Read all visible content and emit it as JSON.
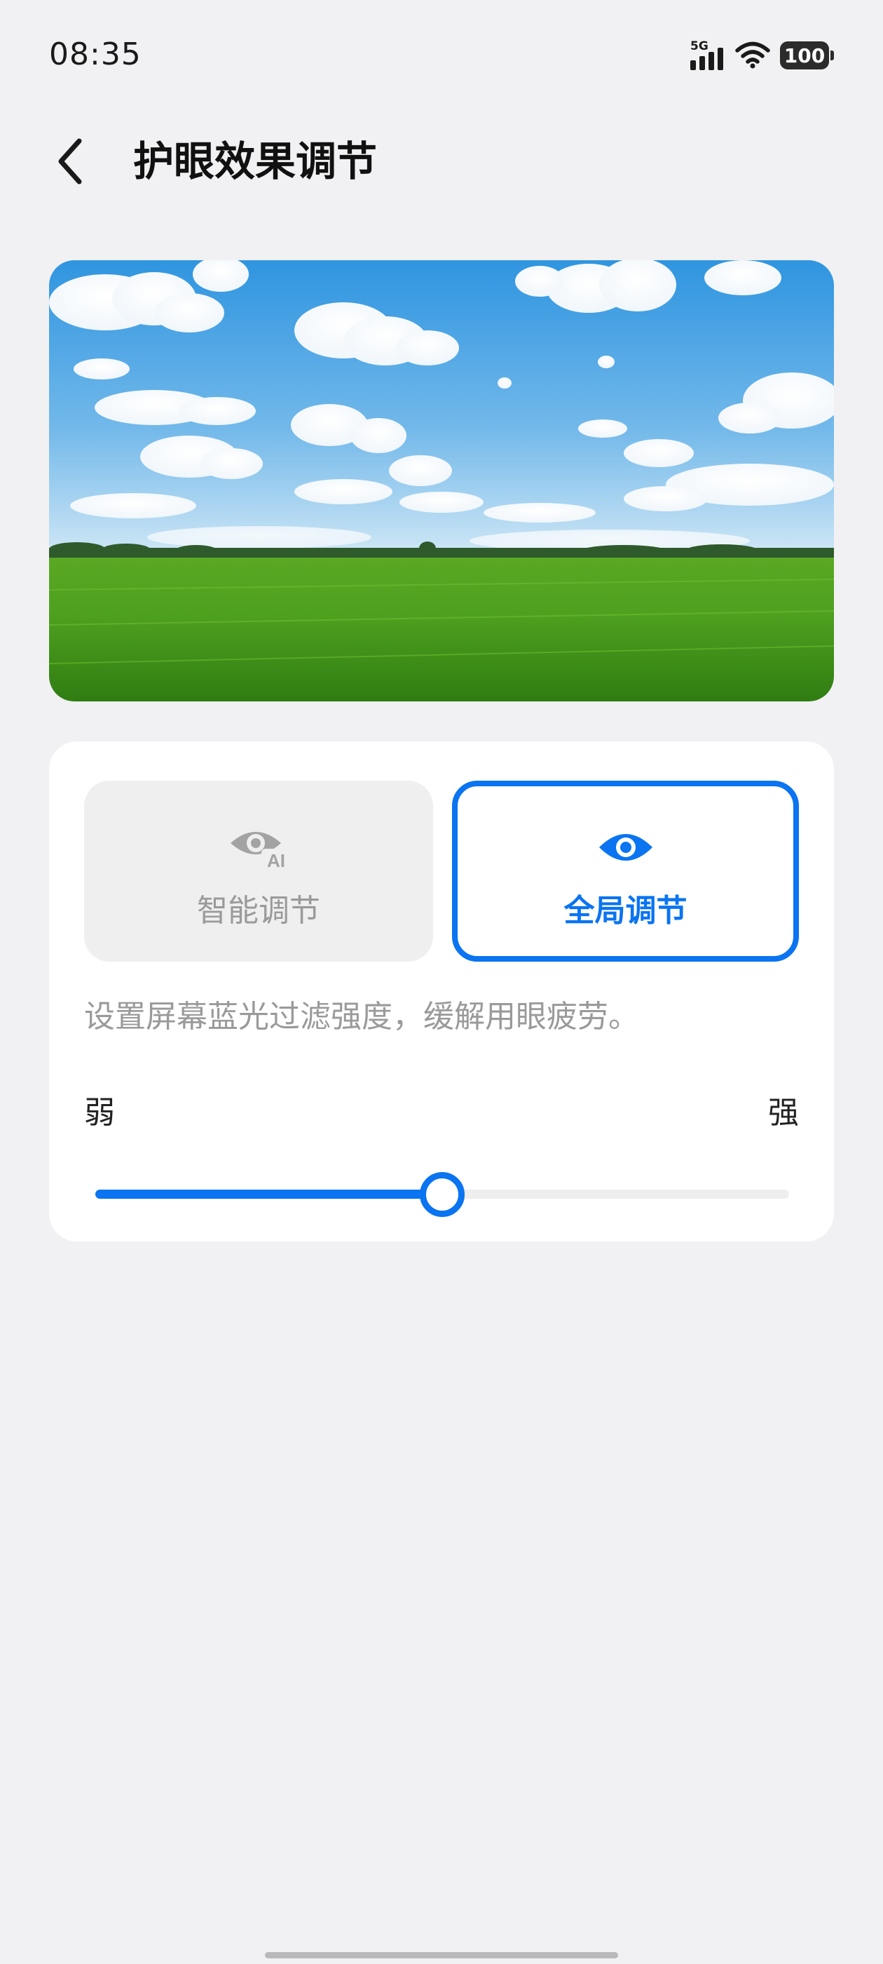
{
  "status_bar": {
    "time": "08:35",
    "network": "5G",
    "battery": "100",
    "icons": [
      "signal-icon",
      "wifi-icon",
      "battery-icon"
    ]
  },
  "header": {
    "back_icon": "chevron-left-icon",
    "title": "护眼效果调节"
  },
  "preview": {
    "image": "grass-field-blue-sky-photo"
  },
  "modes": {
    "items": [
      {
        "label": "智能调节",
        "icon": "eye-ai-icon",
        "selected": false
      },
      {
        "label": "全局调节",
        "icon": "eye-icon",
        "selected": true
      }
    ]
  },
  "description": "设置屏幕蓝光过滤强度，缓解用眼疲劳。",
  "slider": {
    "min_label": "弱",
    "max_label": "强",
    "value": 0.5
  },
  "colors": {
    "accent": "#0a74f1",
    "background": "#f1f1f3",
    "card": "#ffffff",
    "inactive_text": "#9a9a9a"
  }
}
